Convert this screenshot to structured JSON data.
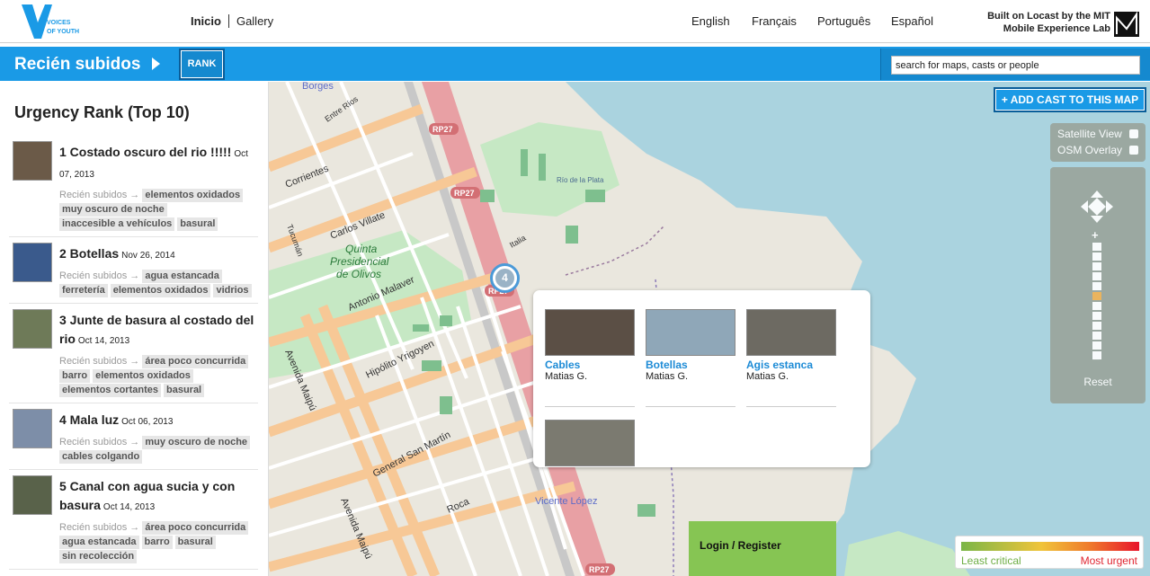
{
  "header": {
    "logo_line1": "VOICES",
    "logo_line2": "OF YOUTH",
    "nav": [
      {
        "label": "Inicio"
      },
      {
        "label": "Gallery"
      }
    ],
    "languages": [
      "English",
      "Français",
      "Português",
      "Español"
    ],
    "credit_line1": "Built on Locast by the MIT",
    "credit_line2": "Mobile Experience Lab",
    "brand_color": "#1a9ae6"
  },
  "bluebar": {
    "map_title": "Recién subidos",
    "rank_label": "RANK",
    "search_placeholder": "search for maps, casts or people"
  },
  "sidebar": {
    "title": "Urgency Rank (Top 10)",
    "items": [
      {
        "head": "1 Costado oscuro del rio !!!!!",
        "date": "Oct 07, 2013",
        "category": "Recién subidos",
        "tags": [
          "elementos oxidados",
          "muy oscuro de noche",
          "inaccesible a vehículos",
          "basural"
        ],
        "thumb": "#6b5a48"
      },
      {
        "head": "2 Botellas",
        "date": "Nov 26, 2014",
        "category": "Recién subidos",
        "tags": [
          "agua estancada",
          "ferretería",
          "elementos oxidados",
          "vidrios"
        ],
        "thumb": "#3a5a8c"
      },
      {
        "head": "3 Junte de basura al costado del rio",
        "date": "Oct 14, 2013",
        "category": "Recién subidos",
        "tags": [
          "área poco concurrida",
          "barro",
          "elementos oxidados",
          "elementos cortantes",
          "basural"
        ],
        "thumb": "#6e7a58"
      },
      {
        "head": "4 Mala luz",
        "date": "Oct 06, 2013",
        "category": "Recién subidos",
        "tags": [
          "muy oscuro de noche",
          "cables colgando"
        ],
        "thumb": "#7d8ea8"
      },
      {
        "head": "5 Canal con agua sucia y con basura",
        "date": "Oct 14, 2013",
        "category": "Recién subidos",
        "tags": [
          "área poco concurrida",
          "agua estancada",
          "barro",
          "basural",
          "sin recolección"
        ],
        "thumb": "#59624a"
      }
    ]
  },
  "map": {
    "add_cast_label": "+ ADD CAST TO THIS MAP",
    "satellite_label": "Satellite View",
    "osm_label": "OSM Overlay",
    "reset_label": "Reset",
    "cluster_count": "4",
    "zoom_level_index": 5,
    "zoom_steps": 12,
    "labels": {
      "borges": "Borges",
      "corrientes": "Corrientes",
      "carlos_villate": "Carlos Villate",
      "quinta1": "Quinta",
      "quinta2": "Presidencial",
      "quinta3": "de Olivos",
      "antonio_malaver": "Antonio Malaver",
      "hipolito": "Hipólito Yrigoyen",
      "general_san_martin": "General San Martín",
      "avenida_maipu": "Avenida Maipú",
      "avenida_maipu2": "Avenida Maipú",
      "roca": "Roca",
      "vicente_lopez": "Vicente López",
      "rio_de_la_plata": "Río de la Plata",
      "rp27a": "RP27",
      "rp27b": "RP27",
      "rp27c": "RP27",
      "rp27d": "RP27",
      "entre_rios": "Entre Ríos",
      "italia": "Italia",
      "tucuman": "Tucumán"
    }
  },
  "popup": {
    "casts": [
      {
        "name": "Cables",
        "author": "Matias G.",
        "img": "#5b4f45"
      },
      {
        "name": "Botellas",
        "author": "Matias G.",
        "img": "#8fa7b8"
      },
      {
        "name": "Agis estanca",
        "author": "Matias G.",
        "img": "#6d6a62"
      },
      {
        "name": "",
        "author": "",
        "img": "#7b7a70"
      }
    ]
  },
  "login": {
    "label": "Login / Register"
  },
  "legend": {
    "least": "Least critical",
    "most": "Most urgent"
  }
}
